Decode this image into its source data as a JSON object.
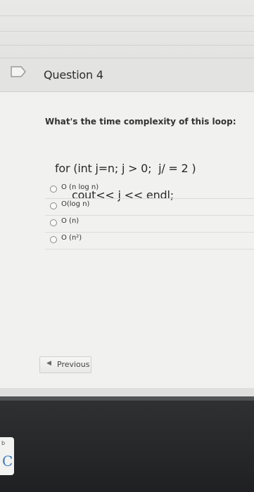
{
  "question": {
    "title": "Question 4",
    "prompt": "What's the time complexity of this loop:",
    "code_line_1": "for (int j=n; j > 0;  j/ = 2 )",
    "code_line_2": "cout<< j << endl;"
  },
  "options": [
    {
      "label": "O (n log n)",
      "selected": false
    },
    {
      "label": "O(log n)",
      "selected": false
    },
    {
      "label": "O (n)",
      "selected": false
    },
    {
      "label": "O (n²)",
      "selected": false
    }
  ],
  "navigation": {
    "previous_label": "Previous"
  },
  "dock": {
    "mini_label": "b",
    "letter": "C"
  },
  "icons": {
    "flag": "flag-icon",
    "previous": "chevron-left-icon"
  }
}
